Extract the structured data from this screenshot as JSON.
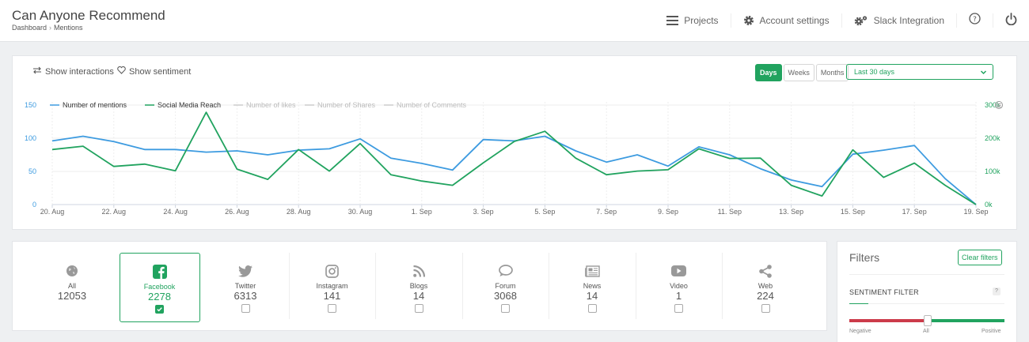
{
  "header": {
    "title": "Can Anyone Recommend",
    "breadcrumb": [
      "Dashboard",
      "Mentions"
    ],
    "nav": {
      "projects": "Projects",
      "account_settings": "Account settings",
      "slack": "Slack Integration"
    }
  },
  "toolbar": {
    "show_interactions": "Show interactions",
    "show_sentiment": "Show sentiment",
    "range_buttons": [
      "Days",
      "Weeks",
      "Months"
    ],
    "active_range": "Days",
    "period": "Last 30 days"
  },
  "chart_data": {
    "type": "line",
    "x_labels": [
      "20. Aug",
      "22. Aug",
      "24. Aug",
      "26. Aug",
      "28. Aug",
      "30. Aug",
      "1. Sep",
      "3. Sep",
      "5. Sep",
      "7. Sep",
      "9. Sep",
      "11. Sep",
      "13. Sep",
      "15. Sep",
      "17. Sep",
      "19. Sep"
    ],
    "x": [
      "20. Aug",
      "21. Aug",
      "22. Aug",
      "23. Aug",
      "24. Aug",
      "25. Aug",
      "26. Aug",
      "27. Aug",
      "28. Aug",
      "29. Aug",
      "30. Aug",
      "31. Aug",
      "1. Sep",
      "2. Sep",
      "3. Sep",
      "4. Sep",
      "5. Sep",
      "6. Sep",
      "7. Sep",
      "8. Sep",
      "9. Sep",
      "10. Sep",
      "11. Sep",
      "12. Sep",
      "13. Sep",
      "14. Sep",
      "15. Sep",
      "16. Sep",
      "17. Sep",
      "18. Sep",
      "19. Sep"
    ],
    "y_left_ticks": [
      "0",
      "50",
      "100",
      "150"
    ],
    "y_left_range": [
      0,
      150
    ],
    "y_right_ticks": [
      "0k",
      "100k",
      "200k",
      "300k"
    ],
    "y_right_range": [
      0,
      300000
    ],
    "legend": [
      "Number of mentions",
      "Social Media Reach",
      "Number of likes",
      "Number of Shares",
      "Number of Comments"
    ],
    "legend_placement": "top-left",
    "series": [
      {
        "name": "Number of mentions",
        "axis": "left",
        "color": "#3d9be0",
        "values": [
          96,
          103,
          95,
          83,
          83,
          79,
          81,
          75,
          82,
          84,
          99,
          70,
          62,
          52,
          98,
          96,
          103,
          81,
          64,
          75,
          58,
          87,
          75,
          54,
          37,
          27,
          76,
          82,
          89,
          39,
          0
        ]
      },
      {
        "name": "Social Media Reach",
        "axis": "right",
        "color": "#21a35f",
        "values": [
          166000,
          176000,
          115000,
          122000,
          102000,
          278000,
          107000,
          76000,
          166000,
          101000,
          184000,
          90000,
          71000,
          58000,
          126000,
          190000,
          221000,
          140000,
          90000,
          101000,
          105000,
          168000,
          139000,
          140000,
          58000,
          26000,
          165000,
          82000,
          125000,
          58000,
          0
        ]
      },
      {
        "name": "Number of likes",
        "color": "#cccccc",
        "values": []
      },
      {
        "name": "Number of Shares",
        "color": "#cccccc",
        "values": []
      },
      {
        "name": "Number of Comments",
        "color": "#cccccc",
        "values": []
      }
    ],
    "grid": true
  },
  "sources": [
    {
      "key": "all",
      "label": "All",
      "count": "12053",
      "icon": "globe-icon",
      "selected": false,
      "has_checkbox": false
    },
    {
      "key": "facebook",
      "label": "Facebook",
      "count": "2278",
      "icon": "facebook-icon",
      "selected": true,
      "has_checkbox": true
    },
    {
      "key": "twitter",
      "label": "Twitter",
      "count": "6313",
      "icon": "twitter-icon",
      "selected": false,
      "has_checkbox": true
    },
    {
      "key": "instagram",
      "label": "Instagram",
      "count": "141",
      "icon": "instagram-icon",
      "selected": false,
      "has_checkbox": true
    },
    {
      "key": "blogs",
      "label": "Blogs",
      "count": "14",
      "icon": "rss-icon",
      "selected": false,
      "has_checkbox": true
    },
    {
      "key": "forum",
      "label": "Forum",
      "count": "3068",
      "icon": "chat-icon",
      "selected": false,
      "has_checkbox": true
    },
    {
      "key": "news",
      "label": "News",
      "count": "14",
      "icon": "newspaper-icon",
      "selected": false,
      "has_checkbox": true
    },
    {
      "key": "video",
      "label": "Video",
      "count": "1",
      "icon": "play-icon",
      "selected": false,
      "has_checkbox": true
    },
    {
      "key": "web",
      "label": "Web",
      "count": "224",
      "icon": "share-icon",
      "selected": false,
      "has_checkbox": true
    }
  ],
  "filters": {
    "title": "Filters",
    "clear_label": "Clear filters",
    "sentiment_label": "SENTIMENT FILTER",
    "help": "?",
    "slider": {
      "negative": "Negative",
      "all": "All",
      "positive": "Positive",
      "value": 0.5
    }
  },
  "colors": {
    "accent": "#21a35f",
    "mentions": "#3d9be0",
    "negative": "#cc3b4a"
  }
}
